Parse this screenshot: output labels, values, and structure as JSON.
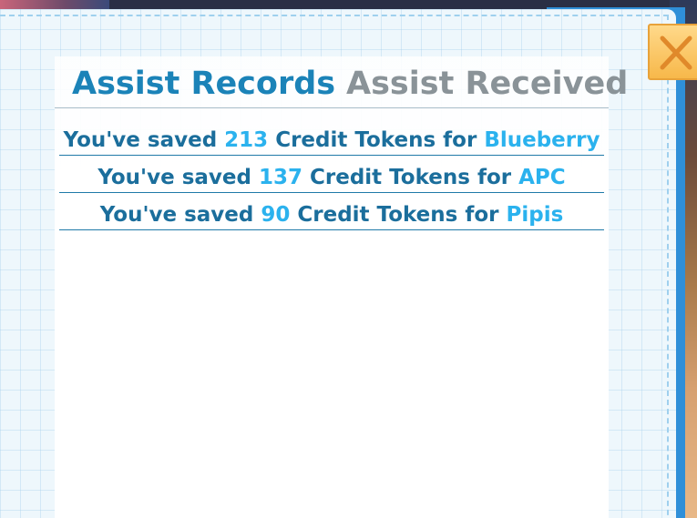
{
  "tabs": {
    "active_label": "Assist Records",
    "inactive_label": "Assist Received"
  },
  "records": [
    {
      "prefix": "You've saved ",
      "amount": "213",
      "middle": " Credit Tokens for ",
      "name": "Blueberry"
    },
    {
      "prefix": "You've saved ",
      "amount": "137",
      "middle": " Credit Tokens for ",
      "name": "APC"
    },
    {
      "prefix": "You've saved ",
      "amount": "90",
      "middle": " Credit Tokens for ",
      "name": "Pipis"
    }
  ],
  "close_button": {
    "icon": "close-icon"
  },
  "colors": {
    "active_tab": "#1b83b8",
    "inactive_tab": "#8a9398",
    "record_text": "#1b6e9c",
    "highlight": "#2bb2ee",
    "close_button": "#f7b84a"
  }
}
